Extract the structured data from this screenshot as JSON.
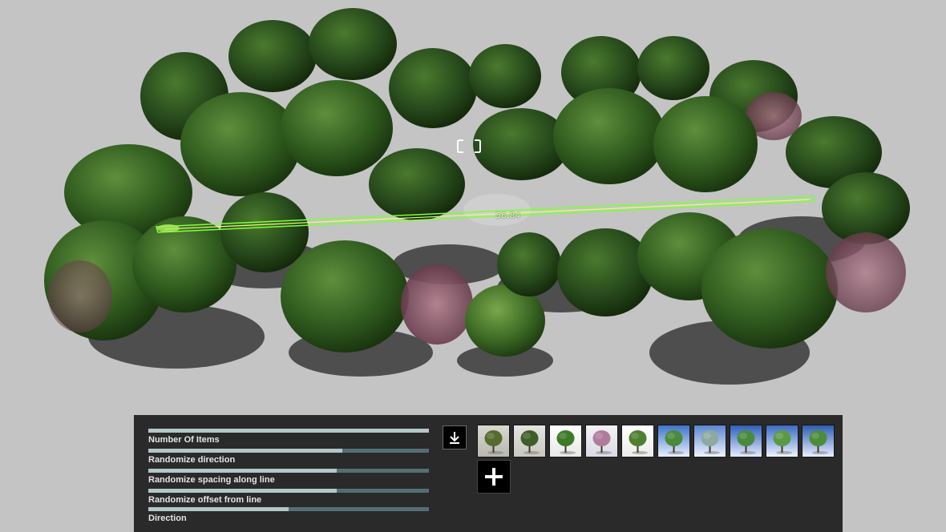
{
  "viewport": {
    "distance_readout": "56.84"
  },
  "panel": {
    "sliders": [
      {
        "label": "Number Of Items",
        "value": 1.0
      },
      {
        "label": "Randomize direction",
        "value": 0.69
      },
      {
        "label": "Randomize spacing along line",
        "value": 0.67
      },
      {
        "label": "Randomize offset from line",
        "value": 0.67
      },
      {
        "label": "Direction",
        "value": 0.5
      }
    ],
    "thumbnails": [
      {
        "name": "tree-thumbnail-1"
      },
      {
        "name": "tree-thumbnail-2"
      },
      {
        "name": "tree-thumbnail-3"
      },
      {
        "name": "tree-thumbnail-4"
      },
      {
        "name": "tree-thumbnail-5"
      },
      {
        "name": "tree-thumbnail-6"
      },
      {
        "name": "tree-thumbnail-7"
      },
      {
        "name": "tree-thumbnail-8"
      },
      {
        "name": "tree-thumbnail-9"
      },
      {
        "name": "tree-thumbnail-10"
      }
    ],
    "download_icon": "download-icon",
    "add_icon": "plus-icon"
  },
  "colors": {
    "background": "#c4c4c4",
    "panel": "#2a2a2a",
    "slider_fill": "#b2c8c6",
    "slider_track": "#536f73",
    "path_line": "#7dff3a"
  }
}
